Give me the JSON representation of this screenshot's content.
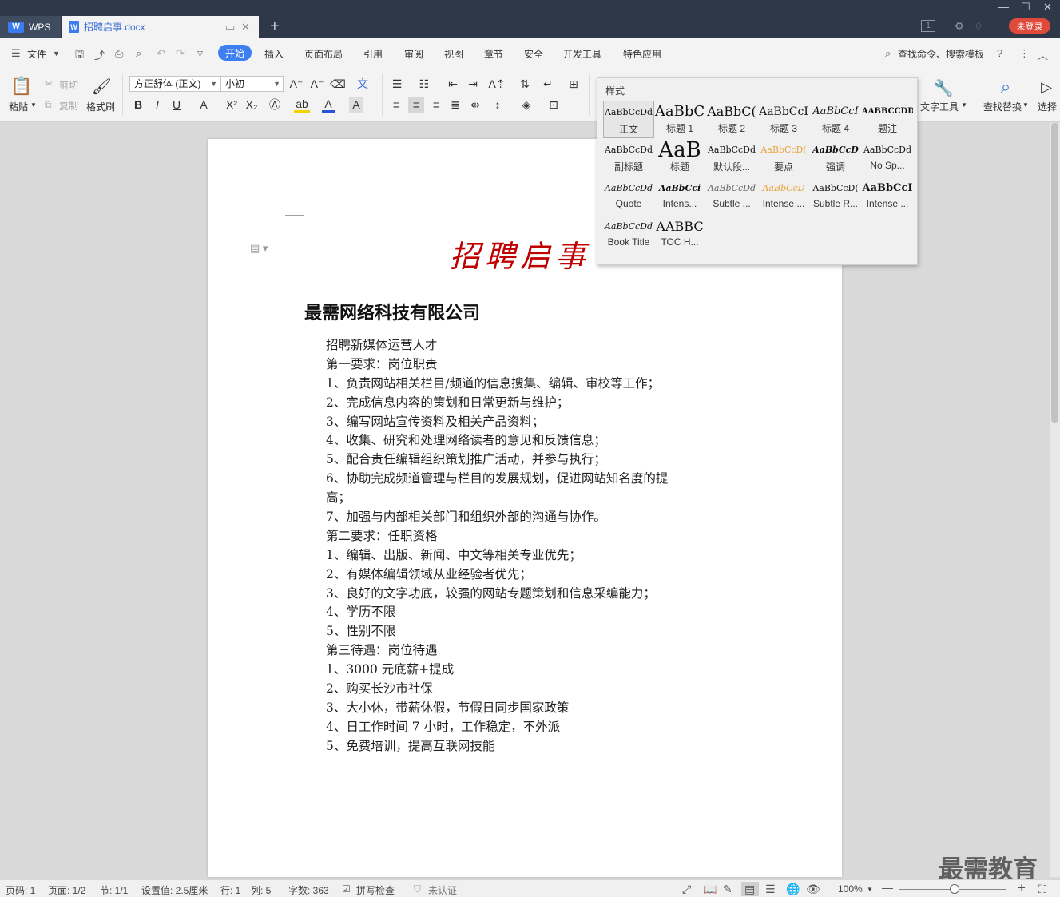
{
  "titlebar": {
    "app_tab": "WPS",
    "doc_tab": "招聘启事.docx",
    "doc_icon": "W",
    "new_tab": "+",
    "login": "未登录",
    "badge": "1"
  },
  "menu": {
    "file": "文件",
    "items": [
      "开始",
      "插入",
      "页面布局",
      "引用",
      "审阅",
      "视图",
      "章节",
      "安全",
      "开发工具",
      "特色应用"
    ],
    "search": "查找命令、搜索模板",
    "help": "?"
  },
  "ribbon": {
    "paste": "粘贴",
    "cut": "剪切",
    "copy": "复制",
    "format_painter": "格式刷",
    "font_name": "方正舒体 (正文)",
    "font_size": "小初",
    "text_tools": "文字工具",
    "find_replace": "查找替换",
    "select": "选择"
  },
  "styles_panel": {
    "header": "样式",
    "items": [
      {
        "sample": "AaBbCcDd",
        "name": "正文"
      },
      {
        "sample": "AaBbC",
        "name": "标题 1"
      },
      {
        "sample": "AaBbC(",
        "name": "标题 2"
      },
      {
        "sample": "AaBbCcI",
        "name": "标题 3"
      },
      {
        "sample": "AaBbCcI",
        "name": "标题 4"
      },
      {
        "sample": "AABBCCDD",
        "name": "题注"
      },
      {
        "sample": "AaBbCcDd",
        "name": "副标题"
      },
      {
        "sample": "AaB",
        "name": "标题"
      },
      {
        "sample": "AaBbCcDd",
        "name": "默认段..."
      },
      {
        "sample": "AaBbCcD(",
        "name": "要点"
      },
      {
        "sample": "AaBbCcD",
        "name": "强调"
      },
      {
        "sample": "AaBbCcDd",
        "name": "No Sp..."
      },
      {
        "sample": "AaBbCcDd",
        "name": "Quote"
      },
      {
        "sample": "AaBbCci",
        "name": "Intens..."
      },
      {
        "sample": "AaBbCcDd",
        "name": "Subtle ..."
      },
      {
        "sample": "AaBbCcD",
        "name": "Intense ..."
      },
      {
        "sample": "AaBbCcD(",
        "name": "Subtle R..."
      },
      {
        "sample": "AaBbCcI",
        "name": "Intense ..."
      },
      {
        "sample": "AaBbCcDd",
        "name": "Book Title"
      },
      {
        "sample": "AABBC",
        "name": "TOC H..."
      }
    ]
  },
  "document": {
    "title": "招聘启事",
    "company": "最需网络科技有限公司",
    "lines": [
      "招聘新媒体运营人才",
      "第一要求：岗位职责",
      "1、负责网站相关栏目/频道的信息搜集、编辑、审校等工作；",
      "2、完成信息内容的策划和日常更新与维护；",
      "3、编写网站宣传资料及相关产品资料；",
      "4、收集、研究和处理网络读者的意见和反馈信息；",
      "5、配合责任编辑组织策划推广活动，并参与执行；",
      "6、协助完成频道管理与栏目的发展规划，促进网站知名度的提",
      "高；",
      "7、加强与内部相关部门和组织外部的沟通与协作。",
      "第二要求：任职资格",
      "1、编辑、出版、新闻、中文等相关专业优先；",
      "2、有媒体编辑领域从业经验者优先；",
      "3、良好的文字功底，较强的网站专题策划和信息采编能力；",
      "4、学历不限",
      "5、性别不限",
      "第三待遇：岗位待遇",
      "1、3000 元底薪+提成",
      "2、购买长沙市社保",
      "3、大小休，带薪休假，节假日同步国家政策",
      "4、日工作时间 7 小时，工作稳定，不外派",
      "5、免费培训，提高互联网技能"
    ]
  },
  "statusbar": {
    "page_num": "页码: 1",
    "pages": "页面: 1/2",
    "section": "节: 1/1",
    "setting": "设置值: 2.5厘米",
    "row": "行: 1",
    "col": "列: 5",
    "word_count": "字数: 363",
    "spell_check": "拼写检查",
    "auth": "未认证",
    "zoom": "100%"
  },
  "watermark": "最需教育"
}
